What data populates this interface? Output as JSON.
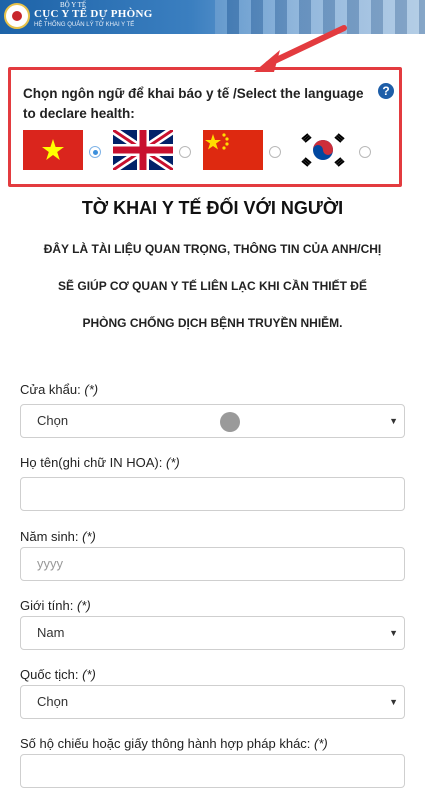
{
  "banner": {
    "ministry": "BỘ Y TẾ",
    "department": "CỤC Y TẾ DỰ PHÒNG",
    "system": "HỆ THỐNG QUẢN LÝ TỜ KHAI Y TẾ"
  },
  "language": {
    "prompt": "Chọn ngôn ngữ để khai báo y tế /Select the language to declare health:",
    "help_icon": "?",
    "options": [
      {
        "name": "vietnam-flag",
        "selected": true
      },
      {
        "name": "uk-flag",
        "selected": false
      },
      {
        "name": "china-flag",
        "selected": false
      },
      {
        "name": "korea-flag",
        "selected": false
      }
    ]
  },
  "form": {
    "title": "TỜ KHAI Y TẾ ĐỐI VỚI NGƯỜI",
    "notice_lines": [
      "ĐÂY LÀ TÀI LIỆU QUAN TRỌNG, THÔNG TIN CỦA ANH/CHỊ",
      "SẼ GIÚP CƠ QUAN Y TẾ LIÊN LẠC KHI CẦN THIẾT ĐỂ",
      "PHÒNG CHỐNG DỊCH BỆNH TRUYỀN NHIỄM."
    ],
    "required_mark": "(*)",
    "fields": {
      "border_gate": {
        "label": "Cửa khẩu:",
        "value": "Chọn"
      },
      "full_name": {
        "label": "Họ tên(ghi chữ IN HOA):",
        "value": ""
      },
      "birth_year": {
        "label": "Năm sinh:",
        "placeholder": "yyyy"
      },
      "gender": {
        "label": "Giới tính:",
        "value": "Nam"
      },
      "nationality": {
        "label": "Quốc tịch:",
        "value": "Chọn"
      },
      "passport": {
        "label": "Số hộ chiếu hoặc giấy thông hành hợp pháp khác:",
        "value": ""
      }
    }
  },
  "colors": {
    "highlight_border": "#e33b3f",
    "arrow": "#e33b3f",
    "help_icon": "#1e5ea8",
    "banner": "#1d63a8"
  }
}
